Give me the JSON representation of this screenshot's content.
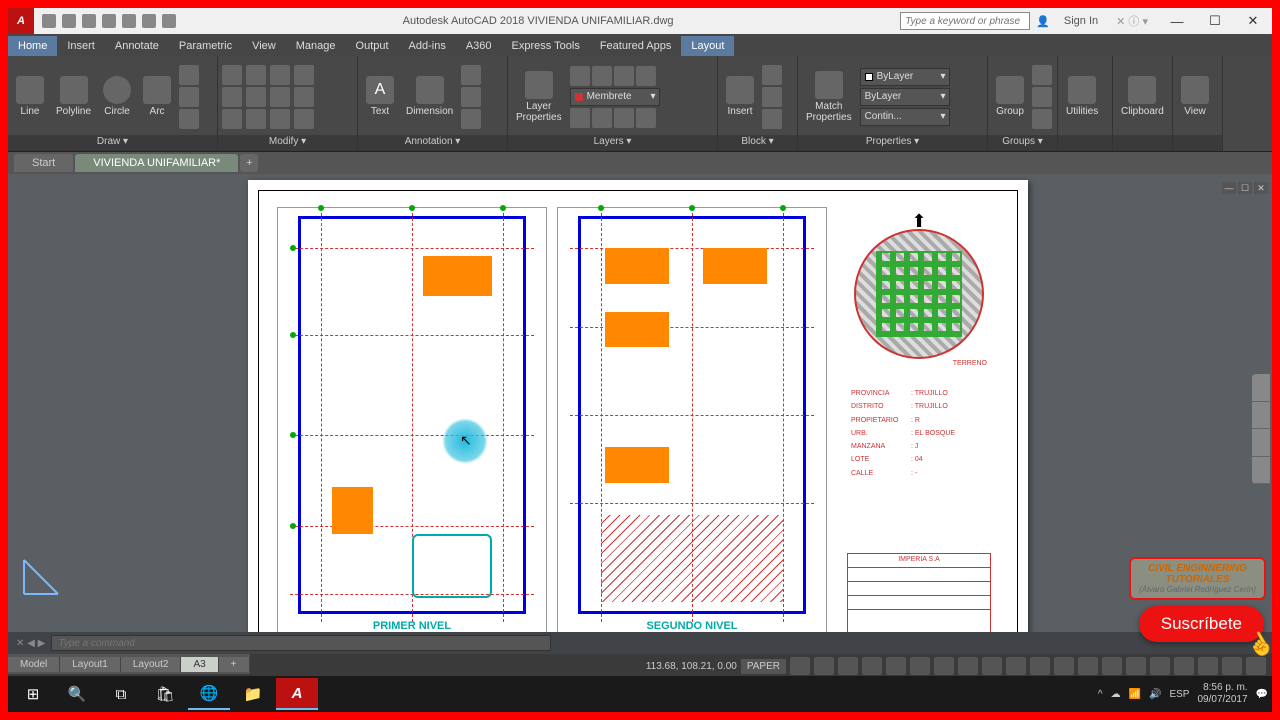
{
  "app": {
    "title": "Autodesk AutoCAD 2018   VIVIENDA UNIFAMILIAR.dwg",
    "logo": "A",
    "search_placeholder": "Type a keyword or phrase",
    "signin": "Sign In"
  },
  "menu": {
    "tabs": [
      "Home",
      "Insert",
      "Annotate",
      "Parametric",
      "View",
      "Manage",
      "Output",
      "Add-ins",
      "A360",
      "Express Tools",
      "Featured Apps",
      "Layout"
    ],
    "active": "Home"
  },
  "ribbon": {
    "draw": {
      "label": "Draw ▾",
      "line": "Line",
      "polyline": "Polyline",
      "circle": "Circle",
      "arc": "Arc"
    },
    "modify": {
      "label": "Modify ▾"
    },
    "annotation": {
      "label": "Annotation ▾",
      "text": "Text",
      "dimension": "Dimension"
    },
    "layers": {
      "label": "Layers ▾",
      "btn": "Layer\nProperties",
      "current": "Membrete"
    },
    "block": {
      "label": "Block ▾",
      "insert": "Insert"
    },
    "properties": {
      "label": "Properties ▾",
      "match": "Match\nProperties",
      "bylayer": "ByLayer",
      "bylayer2": "ByLayer",
      "contin": "Contin..."
    },
    "groups": {
      "label": "Groups ▾",
      "group": "Group"
    },
    "utilities": {
      "label": "Utilities"
    },
    "clipboard": {
      "label": "Clipboard"
    },
    "view": {
      "label": "View"
    }
  },
  "filetabs": {
    "start": "Start",
    "current": "VIVIENDA UNIFAMILIAR*"
  },
  "drawing": {
    "floor1_title": "PRIMER NIVEL",
    "floor2_title": "SEGUNDO NIVEL",
    "location_label": "TERRENO",
    "info": [
      {
        "k": "PROVINCIA",
        "v": ":  TRUJILLO"
      },
      {
        "k": "DISTRITO",
        "v": ":  TRUJILLO"
      },
      {
        "k": "PROPIETARIO",
        "v": ":  R"
      },
      {
        "k": "URB.",
        "v": ":  EL BOSQUE"
      },
      {
        "k": "MANZANA",
        "v": ":  J"
      },
      {
        "k": "LOTE",
        "v": ":  04"
      },
      {
        "k": "CALLE",
        "v": ":  -"
      }
    ],
    "company": "IMPERIA  S.A"
  },
  "command": {
    "placeholder": "Type a command"
  },
  "layouts": {
    "tabs": [
      "Model",
      "Layout1",
      "Layout2",
      "A3"
    ],
    "active": "A3"
  },
  "status": {
    "coords": "113.68, 108.21, 0.00",
    "space": "PAPER"
  },
  "taskbar": {
    "lang": "ESP",
    "time": "8:56 p. m.",
    "date": "09/07/2017"
  },
  "overlay": {
    "channel1": "CIVIL ENGINNERING",
    "channel2": "TUTORIALES",
    "channel3": "(Álvaro Gabriel Rodríguez Cerín)",
    "subscribe": "Suscríbete"
  }
}
